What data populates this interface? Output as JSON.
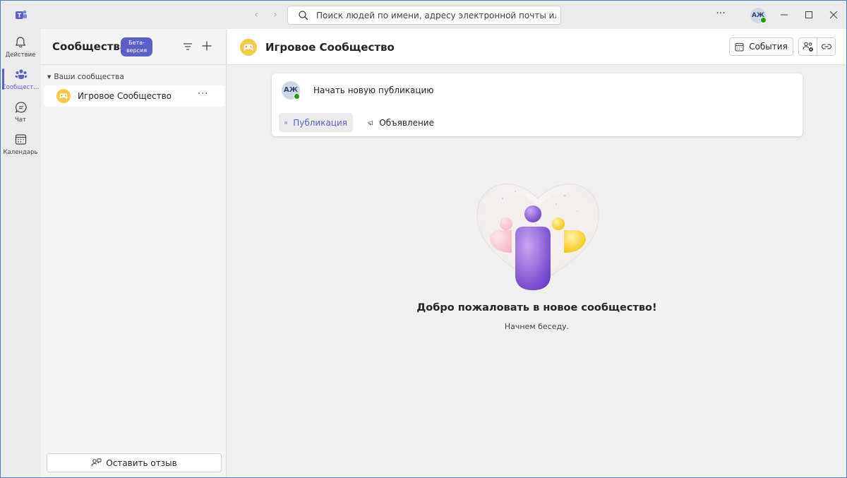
{
  "titlebar": {
    "search_placeholder": "Поиск людей по имени, адресу электронной почты или номеру",
    "user_initials": "АЖ"
  },
  "rail": {
    "items": [
      {
        "label": "Действие",
        "icon": "bell-icon"
      },
      {
        "label": "Сообщест...",
        "icon": "communities-icon",
        "active": true
      },
      {
        "label": "Чат",
        "icon": "chat-icon"
      },
      {
        "label": "Календарь",
        "icon": "calendar-icon"
      }
    ]
  },
  "leftpane": {
    "title": "Сообщества",
    "beta_line1": "Бета-",
    "beta_line2": "версия",
    "section_label": "Ваши сообщества",
    "communities": [
      {
        "name": "Игровое Сообщество",
        "icon": "gamepad-icon"
      }
    ],
    "more_label": "···",
    "feedback_label": "Оставить отзыв"
  },
  "main": {
    "title": "Игровое Сообщество",
    "events_label": "События",
    "composer": {
      "avatar_initials": "АЖ",
      "prompt": "Начать новую публикацию",
      "tabs": [
        {
          "label": "Публикация",
          "active": true
        },
        {
          "label": "Объявление",
          "active": false
        }
      ]
    },
    "welcome_title": "Добро пожаловать в новое сообщество!",
    "welcome_subtitle": "Начнем беседу."
  },
  "colors": {
    "accent": "#5b5fc7",
    "presence": "#13a10e",
    "community_icon": "#f7c948"
  }
}
